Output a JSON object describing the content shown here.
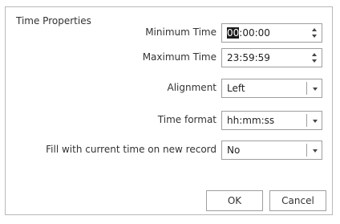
{
  "dialog": {
    "title": "Time  Properties",
    "minimum_time": {
      "label": "Minimum Time",
      "highlighted": "00",
      "rest": ":00:00"
    },
    "maximum_time": {
      "label": "Maximum Time",
      "value": "23:59:59"
    },
    "alignment": {
      "label": "Alignment",
      "value": "Left"
    },
    "time_format": {
      "label": "Time format",
      "value": "hh:mm:ss"
    },
    "fill_current_time": {
      "label": "Fill with current time on new record",
      "value": "No"
    },
    "ok_label": "OK",
    "cancel_label": "Cancel"
  },
  "icons": [
    "spinner-up-icon",
    "spinner-down-icon",
    "chevron-down-icon"
  ]
}
